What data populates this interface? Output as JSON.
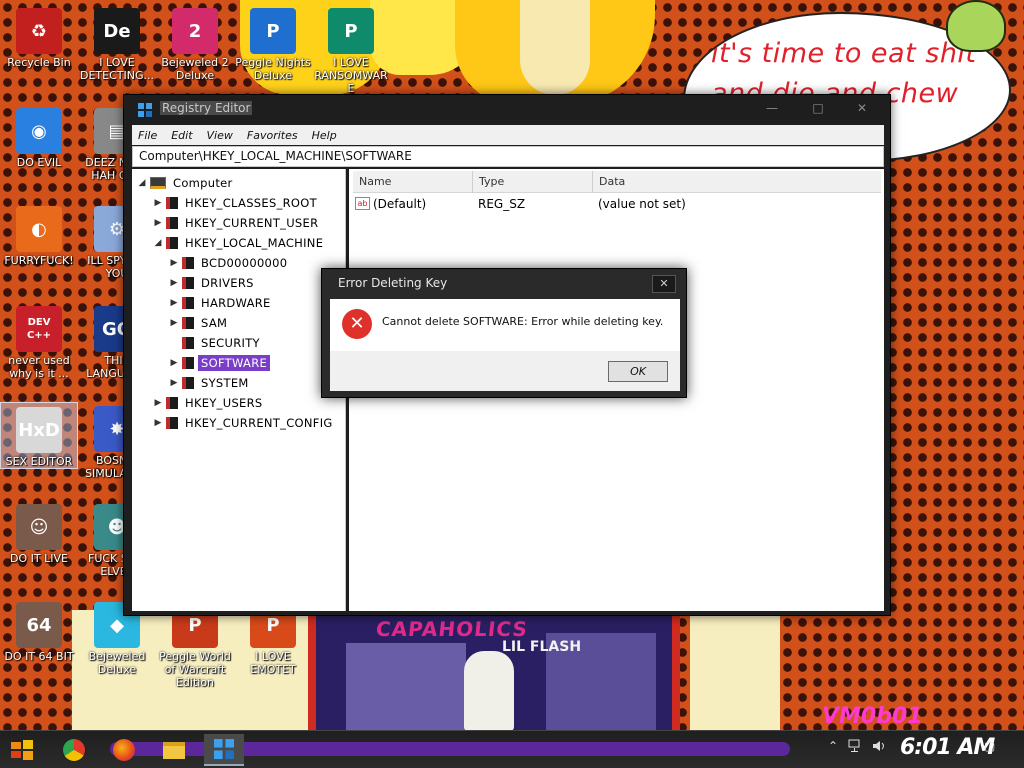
{
  "wallpaper": {
    "speech_bubble": "it's time to eat shit\nand die and chew\nw",
    "album_title": "CAPAHOLICS",
    "album_subtitle": "LIL FLASH",
    "watermark": "VM0b01"
  },
  "desktop_icons": [
    {
      "label": "Recycle Bin",
      "icon": "recycle-bin-icon",
      "color": "#c21f1f",
      "glyph": "♻"
    },
    {
      "label": "I LOVE DETECTING...",
      "icon": "detect-it-easy-icon",
      "color": "#1a1a1a",
      "glyph": "De"
    },
    {
      "label": "Bejeweled 2 Deluxe",
      "icon": "bejeweled-2-icon",
      "color": "#d22a6a",
      "glyph": "2"
    },
    {
      "label": "Peggle Nights Deluxe",
      "icon": "peggle-nights-icon",
      "color": "#1f6fd0",
      "glyph": "P"
    },
    {
      "label": "I LOVE RANSOMWARE",
      "icon": "publisher-icon",
      "color": "#0f8a6a",
      "glyph": "P"
    },
    {
      "label": "DO EVIL",
      "icon": "chrome-icon",
      "color": "#2a80e0",
      "glyph": "◉"
    },
    {
      "label": "DEEZ NUTS HAH GOT",
      "icon": "generic-file-icon",
      "color": "#888888",
      "glyph": "▤"
    },
    {
      "label": "FURRYFUCK!",
      "icon": "firefox-icon",
      "color": "#e86a1a",
      "glyph": "◐"
    },
    {
      "label": "ILL SPY ON YOU",
      "icon": "spy-tool-icon",
      "color": "#8aa8d8",
      "glyph": "⚙"
    },
    {
      "label": "never used why is it ...",
      "icon": "dev-cpp-icon",
      "color": "#c8202a",
      "glyph": "DEV C++"
    },
    {
      "label": "THIS LANGUAGE",
      "icon": "go-language-icon",
      "color": "#1a3a8a",
      "glyph": "GO"
    },
    {
      "label": "SEX EDITOR",
      "icon": "hxd-hex-editor-icon",
      "color": "#d8d8d8",
      "glyph": "HxD"
    },
    {
      "label": "BOSNIA SIMULATOR",
      "icon": "simulator-icon",
      "color": "#3a5ac8",
      "glyph": "✸"
    },
    {
      "label": "DO IT LIVE",
      "icon": "portrait-icon",
      "color": "#7a5a4a",
      "glyph": "☺"
    },
    {
      "label": "FUCK SHIT ELVES",
      "icon": "elves-game-icon",
      "color": "#3a8a8a",
      "glyph": "☻"
    },
    {
      "label": "DO IT 64 BIT",
      "icon": "portrait-64-icon",
      "color": "#7a5a4a",
      "glyph": "64"
    },
    {
      "label": "Bejeweled Deluxe",
      "icon": "bejeweled-icon",
      "color": "#2ab8e0",
      "glyph": "◆"
    },
    {
      "label": "Peggle World of Warcraft Edition",
      "icon": "peggle-wow-icon",
      "color": "#c83a1a",
      "glyph": "P"
    },
    {
      "label": "I LOVE EMOTET",
      "icon": "powerpoint-icon",
      "color": "#d84a1a",
      "glyph": "P"
    }
  ],
  "regedit": {
    "title": "Registry Editor",
    "minimize": "—",
    "maximize": "□",
    "close": "✕",
    "menu": [
      "File",
      "Edit",
      "View",
      "Favorites",
      "Help"
    ],
    "address": "Computer\\HKEY_LOCAL_MACHINE\\SOFTWARE",
    "tree": [
      {
        "label": "Computer",
        "level": 0,
        "arrow": "◢",
        "kind": "computer"
      },
      {
        "label": "HKEY_CLASSES_ROOT",
        "level": 1,
        "arrow": "▶",
        "kind": "folder"
      },
      {
        "label": "HKEY_CURRENT_USER",
        "level": 1,
        "arrow": "▶",
        "kind": "folder"
      },
      {
        "label": "HKEY_LOCAL_MACHINE",
        "level": 1,
        "arrow": "◢",
        "kind": "folder"
      },
      {
        "label": "BCD00000000",
        "level": 2,
        "arrow": "▶",
        "kind": "folder"
      },
      {
        "label": "DRIVERS",
        "level": 2,
        "arrow": "▶",
        "kind": "folder"
      },
      {
        "label": "HARDWARE",
        "level": 2,
        "arrow": "▶",
        "kind": "folder"
      },
      {
        "label": "SAM",
        "level": 2,
        "arrow": "▶",
        "kind": "folder"
      },
      {
        "label": "SECURITY",
        "level": 2,
        "arrow": "",
        "kind": "folder"
      },
      {
        "label": "SOFTWARE",
        "level": 2,
        "arrow": "▶",
        "kind": "folder",
        "selected": true
      },
      {
        "label": "SYSTEM",
        "level": 2,
        "arrow": "▶",
        "kind": "folder"
      },
      {
        "label": "HKEY_USERS",
        "level": 1,
        "arrow": "▶",
        "kind": "folder"
      },
      {
        "label": "HKEY_CURRENT_CONFIG",
        "level": 1,
        "arrow": "▶",
        "kind": "folder"
      }
    ],
    "columns": {
      "name": "Name",
      "type": "Type",
      "data": "Data"
    },
    "values": [
      {
        "icon": "ab",
        "name": "(Default)",
        "type": "REG_SZ",
        "data": "(value not set)"
      }
    ]
  },
  "error_dialog": {
    "title": "Error Deleting Key",
    "close": "✕",
    "message": "Cannot delete SOFTWARE:  Error while deleting key.",
    "ok": "OK",
    "icon_glyph": "✕"
  },
  "taskbar": {
    "clock": "6:01 AM",
    "tray_icons": [
      "network-icon",
      "volume-icon"
    ],
    "notifications_glyph": "▢"
  }
}
